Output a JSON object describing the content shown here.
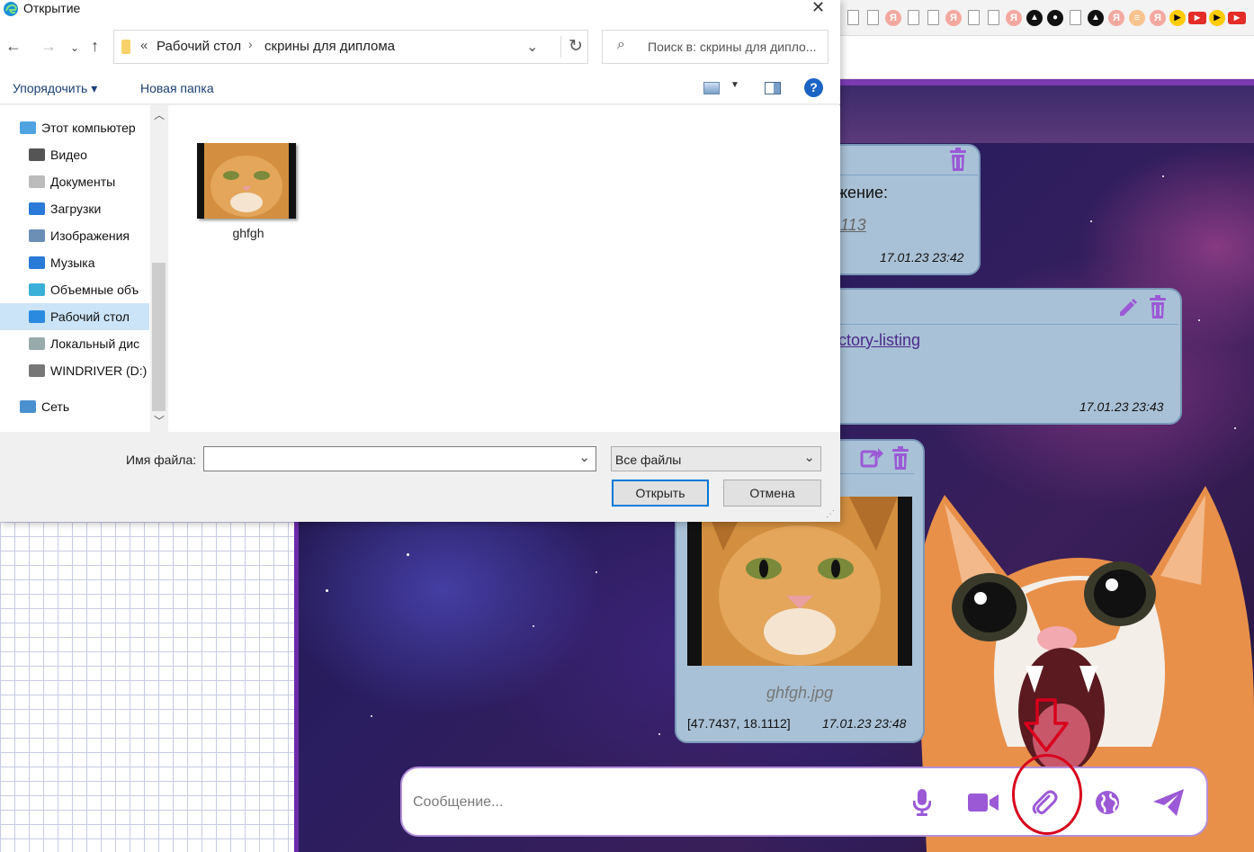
{
  "dialog": {
    "title": "Открытие",
    "breadcrumb_prefix": "«",
    "path_parts": [
      "Рабочий стол",
      "скрины для диплома"
    ],
    "search_placeholder": "Поиск в: скрины для дипло...",
    "organize_label": "Упорядочить ▾",
    "new_folder_label": "Новая папка",
    "help_label": "?",
    "nav_items": [
      {
        "label": "Этот компьютер",
        "icon": "computer-icon"
      },
      {
        "label": "Видео",
        "icon": "video-icon"
      },
      {
        "label": "Документы",
        "icon": "documents-icon"
      },
      {
        "label": "Загрузки",
        "icon": "downloads-icon"
      },
      {
        "label": "Изображения",
        "icon": "images-icon"
      },
      {
        "label": "Музыка",
        "icon": "music-icon"
      },
      {
        "label": "Объемные объ",
        "icon": "3d-objects-icon"
      },
      {
        "label": "Рабочий стол",
        "icon": "desktop-icon"
      },
      {
        "label": "Локальный дис",
        "icon": "local-disk-icon"
      },
      {
        "label": "WINDRIVER (D:)",
        "icon": "drive-icon"
      },
      {
        "label": "Сеть",
        "icon": "network-icon"
      }
    ],
    "files": [
      {
        "name": "ghfgh"
      }
    ],
    "filename_label": "Имя файла:",
    "filename_value": "",
    "filetype_value": "Все файлы",
    "open_label": "Открыть",
    "cancel_label": "Отмена"
  },
  "chat": {
    "messages": [
      {
        "text_line1": "жение:",
        "text_line2": "113",
        "time": "17.01.23 23:42"
      },
      {
        "link": "ctory-listing",
        "time": "17.01.23 23:43"
      },
      {
        "filename": "ghfgh.jpg",
        "coords": "[47.7437, 18.1112]",
        "time": "17.01.23 23:48"
      }
    ],
    "composer": {
      "placeholder": "Сообщение..."
    }
  },
  "colors": {
    "accent": "#9b59d6",
    "bubble": "#a9c1d6",
    "highlight": "#d8001c"
  }
}
